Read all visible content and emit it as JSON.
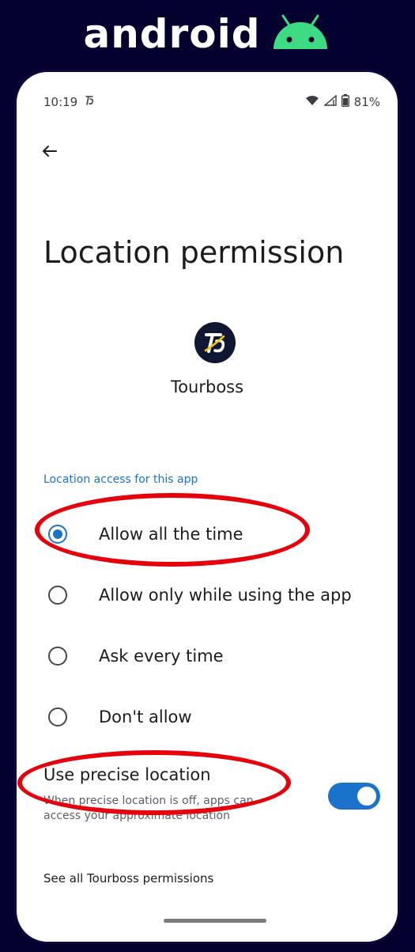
{
  "brand": {
    "wordmark": "android",
    "logo_icon": "android-robot-icon"
  },
  "status_bar": {
    "time": "10:19",
    "battery": "81%",
    "icons": [
      "tourboss-notification-icon",
      "wifi-icon",
      "signal-icon",
      "battery-icon"
    ]
  },
  "header": {
    "back_icon": "arrow-left-icon",
    "title": "Location permission"
  },
  "app": {
    "name": "Tourboss",
    "icon": "tourboss-logo-icon"
  },
  "location_section": {
    "label": "Location access for this app",
    "options": [
      {
        "label": "Allow all the time",
        "selected": true
      },
      {
        "label": "Allow only while using the app",
        "selected": false
      },
      {
        "label": "Ask every time",
        "selected": false
      },
      {
        "label": "Don't allow",
        "selected": false
      }
    ]
  },
  "precise_location": {
    "title": "Use precise location",
    "description": "When precise location is off, apps can access your approximate location",
    "enabled": true
  },
  "see_all": "See all Tourboss permissions",
  "colors": {
    "accent": "#1a73c8",
    "annotation": "#e5000b",
    "background": "#03002e",
    "android_green": "#3ddc84"
  }
}
